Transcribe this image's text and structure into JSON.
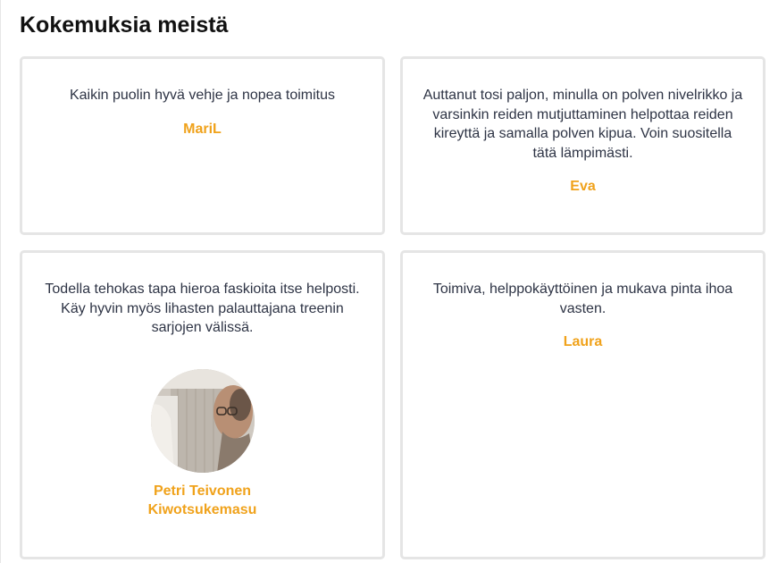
{
  "section": {
    "title": "Kokemuksia meistä"
  },
  "testimonials": [
    {
      "quote": "Kaikin puolin hyvä vehje ja nopea toimitus",
      "author": "MariL"
    },
    {
      "quote": "Auttanut tosi paljon, minulla on polven nivelrikko ja varsinkin reiden mutjuttaminen helpottaa reiden kireyttä ja samalla polven kipua. Voin suositella tätä lämpimästi.",
      "author": "Eva"
    },
    {
      "quote": "Todella tehokas tapa hieroa faskioita itse helposti. Käy hyvin myös lihasten palauttajana treenin sarjojen välissä.",
      "author_line1": "Petri Teivonen",
      "author_line2": "Kiwotsukemasu",
      "avatar_icon": "person-photo-avatar"
    },
    {
      "quote": "Toimiva, helppokäyttöinen ja mukava pinta ihoa vasten.",
      "author": "Laura"
    }
  ],
  "colors": {
    "author": "#f0a21b",
    "text": "#2e3445",
    "card_border": "#e5e5e5"
  }
}
